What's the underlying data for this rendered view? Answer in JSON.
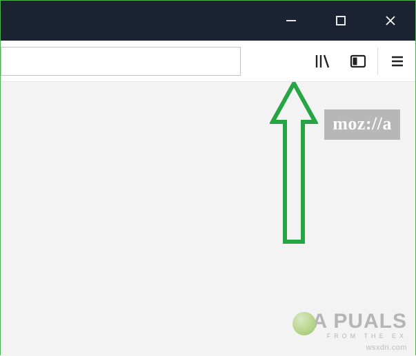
{
  "titlebar": {
    "minimize_symbol": "─",
    "maximize_symbol": "☐",
    "close_symbol": "✕"
  },
  "toolbar": {
    "library_icon": "library-icon",
    "sidebar_icon": "sidebar-icon",
    "menu_icon": "menu-icon"
  },
  "content": {
    "mozilla_badge": "moz://a"
  },
  "watermarks": {
    "appuals_line1": "A  PUALS",
    "appuals_line2": "FROM THE EX",
    "site": "wsxdn.com"
  }
}
